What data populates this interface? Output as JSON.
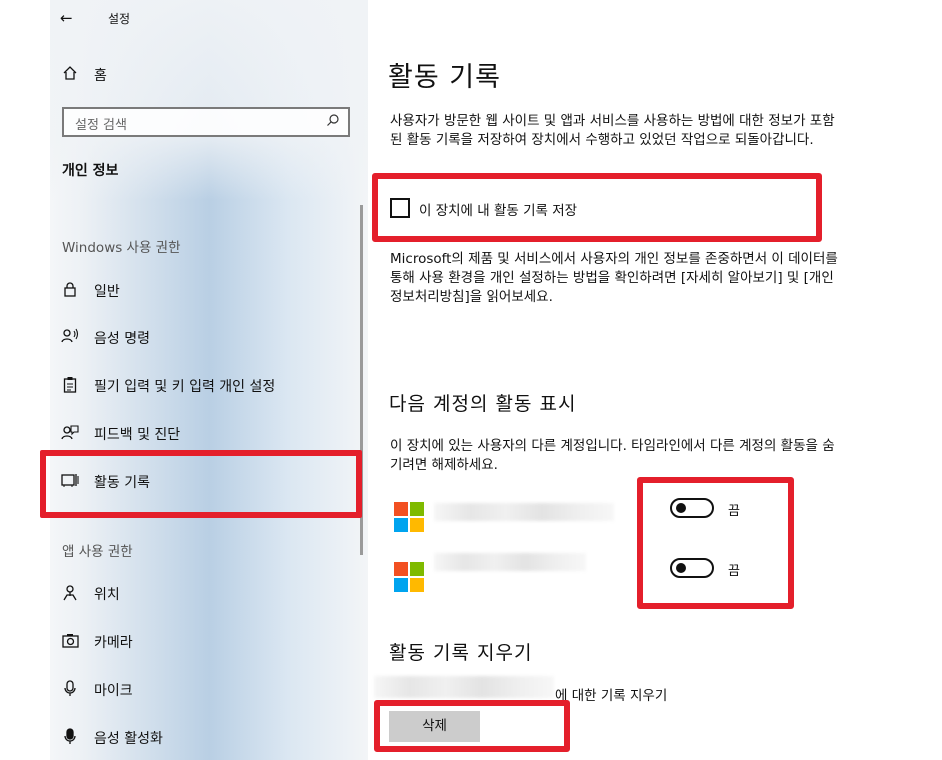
{
  "sidebar": {
    "back_icon": "arrow-left-icon",
    "app_title": "설정",
    "home_label": "홈",
    "search_placeholder": "설정 검색",
    "section_title": "개인 정보",
    "windows_group": "Windows 사용 권한",
    "windows_items": [
      {
        "icon": "lock-icon",
        "label": "일반"
      },
      {
        "icon": "voice-icon",
        "label": "음성 명령"
      },
      {
        "icon": "clipboard-icon",
        "label": "필기 입력 및 키 입력 개인 설정"
      },
      {
        "icon": "feedback-icon",
        "label": "피드백 및 진단"
      },
      {
        "icon": "activity-icon",
        "label": "활동 기록"
      }
    ],
    "app_group": "앱 사용 권한",
    "app_items": [
      {
        "icon": "location-icon",
        "label": "위치"
      },
      {
        "icon": "camera-icon",
        "label": "카메라"
      },
      {
        "icon": "microphone-icon",
        "label": "마이크"
      },
      {
        "icon": "voice-activation-icon",
        "label": "음성 활성화"
      }
    ],
    "active_item": "활동 기록"
  },
  "main": {
    "title": "활동 기록",
    "intro": "사용자가 방문한 웹 사이트 및 앱과 서비스를 사용하는 방법에 대한 정보가 포함된 활동 기록을 저장하여 장치에서 수행하고 있었던 작업으로 되돌아갑니다.",
    "store_checkbox": {
      "label": "이 장치에 내 활동 기록 저장",
      "checked": false
    },
    "privacy_text": "Microsoft의 제품 및 서비스에서 사용자의 개인 정보를 존중하면서 이 데이터를 통해 사용 환경을 개인 설정하는 방법을 확인하려면 [자세히 알아보기] 및 [개인정보처리방침]을 읽어보세요.",
    "accounts_heading": "다음 계정의 활동 표시",
    "accounts_desc": "이 장치에 있는 사용자의 다른 계정입니다. 타임라인에서 다른 계정의 활동을 숨기려면 해제하세요.",
    "accounts": [
      {
        "toggle_label": "끔",
        "on": false
      },
      {
        "toggle_label": "끔",
        "on": false
      }
    ],
    "clear_heading": "활동 기록 지우기",
    "clear_suffix": "에 대한 기록 지우기",
    "delete_button": "삭제"
  },
  "colors": {
    "highlight_red": "#e41f2b",
    "ms_red": "#f25022",
    "ms_green": "#7fba00",
    "ms_blue": "#00a4ef",
    "ms_yellow": "#ffb900"
  }
}
